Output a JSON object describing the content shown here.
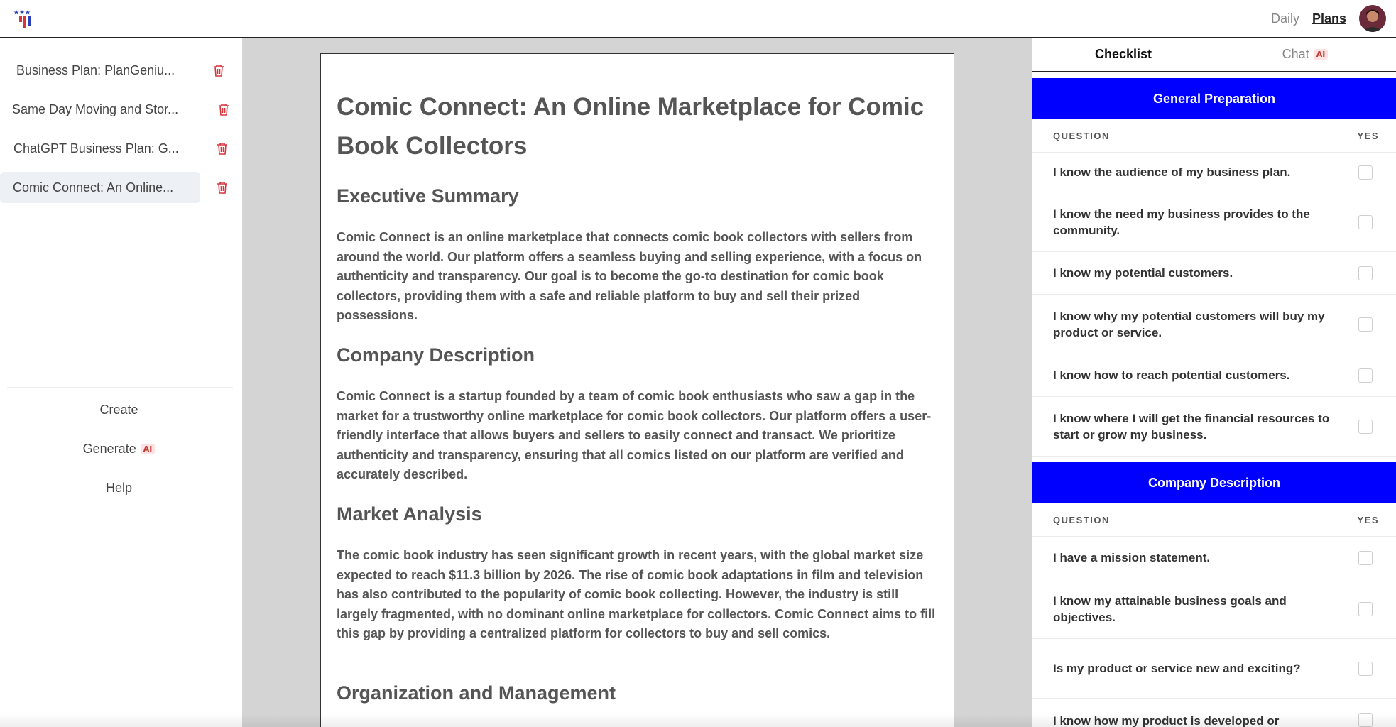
{
  "header": {
    "nav": [
      {
        "label": "Daily",
        "active": false
      },
      {
        "label": "Plans",
        "active": true
      }
    ],
    "logo_icon": "flag-logo-icon",
    "avatar_icon": "user-avatar"
  },
  "sidebar": {
    "plans": [
      {
        "label": "Business Plan: PlanGeniu...",
        "selected": false
      },
      {
        "label": "Same Day Moving and Stor...",
        "selected": false
      },
      {
        "label": "ChatGPT Business Plan: G...",
        "selected": false
      },
      {
        "label": "Comic Connect: An Online...",
        "selected": true
      }
    ],
    "actions": {
      "create": "Create",
      "generate": "Generate",
      "generate_badge": "AI",
      "help": "Help"
    }
  },
  "document": {
    "title": "Comic Connect: An Online Marketplace for Comic Book Collectors",
    "sections": [
      {
        "heading": "Executive Summary",
        "body": "Comic Connect is an online marketplace that connects comic book collectors with sellers from around the world. Our platform offers a seamless buying and selling experience, with a focus on authenticity and transparency. Our goal is to become the go-to destination for comic book collectors, providing them with a safe and reliable platform to buy and sell their prized possessions."
      },
      {
        "heading": "Company Description",
        "body": "Comic Connect is a startup founded by a team of comic book enthusiasts who saw a gap in the market for a trustworthy online marketplace for comic book collectors. Our platform offers a user-friendly interface that allows buyers and sellers to easily connect and transact. We prioritize authenticity and transparency, ensuring that all comics listed on our platform are verified and accurately described."
      },
      {
        "heading": "Market Analysis",
        "body": "The comic book industry has seen significant growth in recent years, with the global market size expected to reach $11.3 billion by 2026. The rise of comic book adaptations in film and television has also contributed to the popularity of comic book collecting. However, the industry is still largely fragmented, with no dominant online marketplace for collectors. Comic Connect aims to fill this gap by providing a centralized platform for collectors to buy and sell comics."
      },
      {
        "heading": "Organization and Management",
        "body": ""
      }
    ]
  },
  "right_panel": {
    "tabs": {
      "checklist": "Checklist",
      "chat": "Chat",
      "chat_badge": "AI"
    },
    "column_question": "QUESTION",
    "column_yes": "YES",
    "sections": [
      {
        "title": "General Preparation",
        "questions": [
          "I know the audience of my business plan.",
          "I know the need my business provides to the community.",
          "I know my potential customers.",
          "I know why my potential customers will buy my product or service.",
          "I know how to reach potential customers.",
          "I know where I will get the financial resources to start or grow my business."
        ]
      },
      {
        "title": "Company Description",
        "questions": [
          "I have a mission statement.",
          "I know my attainable business goals and objectives.",
          "Is my product or service new and exciting?",
          "I know how my product is developed or"
        ]
      }
    ],
    "colors": {
      "section_header": "#0000ff",
      "ai_badge": "#fde2e4"
    }
  }
}
